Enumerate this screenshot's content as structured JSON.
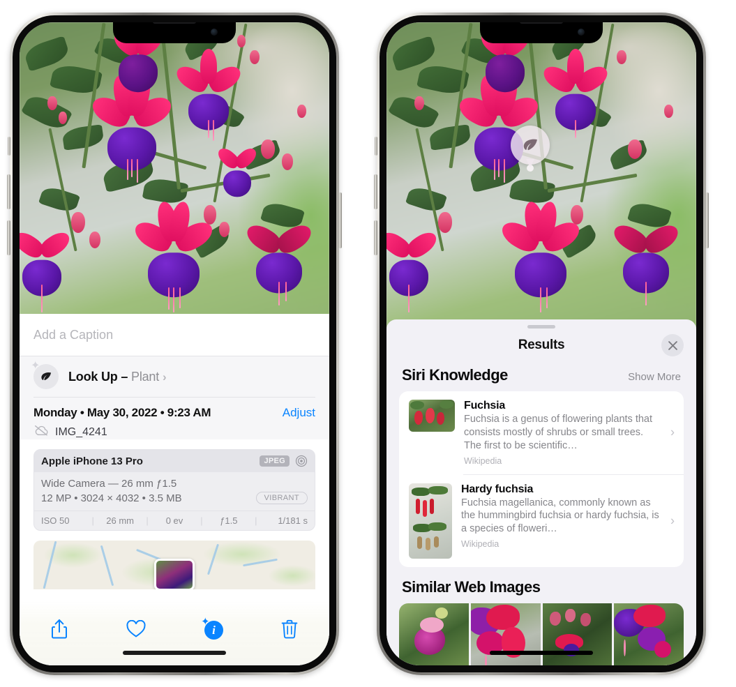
{
  "left_phone": {
    "caption": {
      "placeholder": "Add a Caption",
      "value": ""
    },
    "lookup": {
      "label": "Look Up –",
      "subject": "Plant",
      "icon": "leaf-icon",
      "chevron": "›",
      "sparkle": "✦"
    },
    "meta": {
      "date_line": "Monday • May 30, 2022 • 9:23 AM",
      "adjust_label": "Adjust",
      "filename": "IMG_4241",
      "cloud_icon": "cloud-slash-icon"
    },
    "exif": {
      "model": "Apple iPhone 13 Pro",
      "format_badge": "JPEG",
      "aperture_icon": "aperture-icon",
      "lens_line": "Wide Camera — 26 mm ƒ1.5",
      "specs_line": "12 MP • 3024 × 4032 • 3.5 MB",
      "style_badge": "VIBRANT",
      "stats": [
        "ISO 50",
        "26 mm",
        "0 ev",
        "ƒ1.5",
        "1/181 s"
      ]
    },
    "toolbar": [
      {
        "name": "share-button",
        "label": "share-icon"
      },
      {
        "name": "favorite-button",
        "label": "heart-icon"
      },
      {
        "name": "info-button",
        "label": "info-sparkle-icon",
        "glyph": "i",
        "sparkle": "✦",
        "accent": "#0a84ff"
      },
      {
        "name": "delete-button",
        "label": "trash-icon"
      }
    ]
  },
  "right_phone": {
    "visual_lookup_badge": {
      "icon": "leaf-icon",
      "name": "visual-lookup-badge"
    },
    "sheet": {
      "title": "Results",
      "close_label": "✕",
      "sections": [
        {
          "title": "Siri Knowledge",
          "action": "Show More",
          "items": [
            {
              "title": "Fuchsia",
              "desc": "Fuchsia is a genus of flowering plants that consists mostly of shrubs or small trees. The first to be scientific…",
              "source": "Wikipedia",
              "chevron": "›"
            },
            {
              "title": "Hardy fuchsia",
              "desc": "Fuchsia magellanica, commonly known as the hummingbird fuchsia or hardy fuchsia, is a species of floweri…",
              "source": "Wikipedia",
              "chevron": "›"
            }
          ]
        },
        {
          "title": "Similar Web Images",
          "action": "",
          "images": [
            {
              "name": "web-image-1"
            },
            {
              "name": "web-image-2"
            },
            {
              "name": "web-image-3"
            },
            {
              "name": "web-image-4"
            }
          ]
        }
      ]
    }
  },
  "colors": {
    "accent_blue": "#0a84ff",
    "sheet_bg": "#f2f1f6",
    "card_bg": "#ffffff",
    "secondary_text": "#86868b",
    "exif_bg": "#eeeef1"
  }
}
